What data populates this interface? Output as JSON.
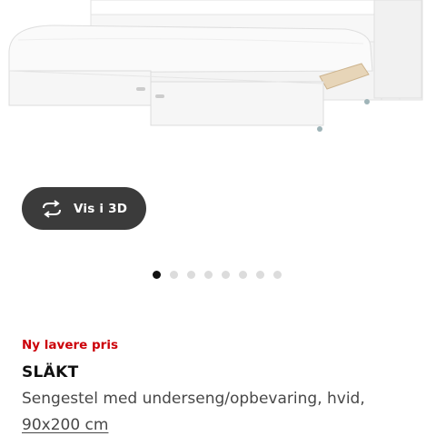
{
  "view_3d_button": {
    "label": "Vis i 3D",
    "icon": "rotate-3d-icon"
  },
  "carousel": {
    "count": 8,
    "active_index": 0
  },
  "product": {
    "badge": "Ny lavere pris",
    "name": "SLÄKT",
    "description": "Sengestel med underseng/opbevaring, hvid,",
    "size": "90x200 cm"
  },
  "colors": {
    "badge_red": "#cc0008",
    "button_bg": "#3b3b3b",
    "dot_active": "#111111",
    "dot_inactive": "#dcdcdc"
  }
}
